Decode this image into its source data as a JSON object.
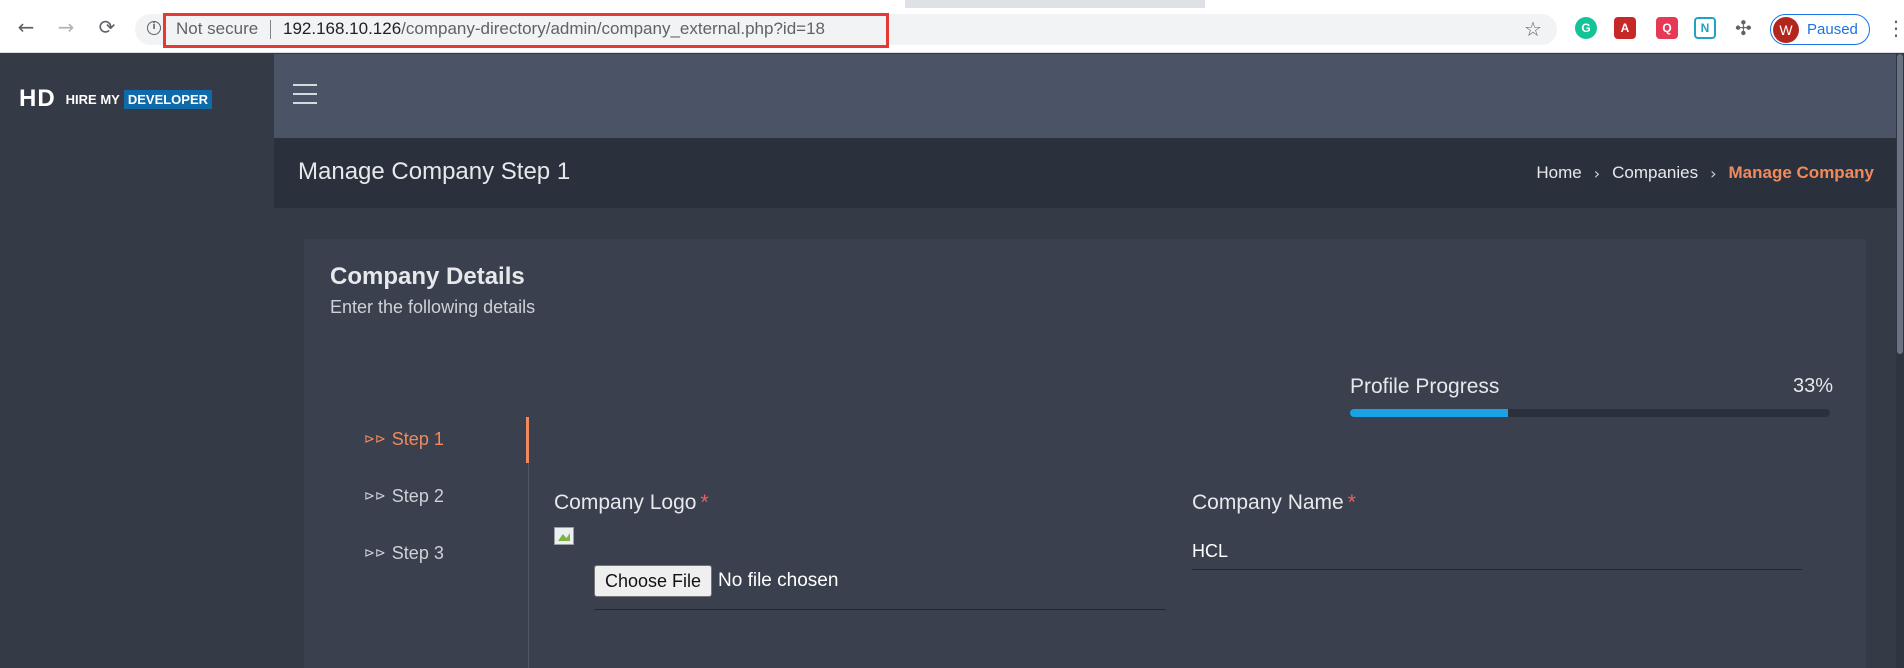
{
  "browser": {
    "security_label": "Not secure",
    "url_host": "192.168.10.126",
    "url_path": "/company-directory/admin/company_external.php?id=18",
    "profile_initial": "W",
    "profile_status": "Paused"
  },
  "sidebar": {
    "logo_mark": "HD",
    "logo_text": "HIRE MY",
    "logo_highlight": "DEVELOPER"
  },
  "header": {
    "page_title": "Manage Company Step 1",
    "breadcrumb": [
      "Home",
      "Companies",
      "Manage Company"
    ]
  },
  "card": {
    "title": "Company Details",
    "subtitle": "Enter the following details",
    "progress_label": "Profile Progress",
    "progress_value": "33%",
    "progress_fraction": 0.33
  },
  "steps": [
    {
      "label": "Step 1",
      "active": true
    },
    {
      "label": "Step 2",
      "active": false
    },
    {
      "label": "Step 3",
      "active": false
    }
  ],
  "form": {
    "logo_label": "Company Logo",
    "name_label": "Company Name",
    "required_mark": "*",
    "file_button": "Choose File",
    "file_status": "No file chosen",
    "company_name": "HCL"
  },
  "colors": {
    "accent": "#f08a5d",
    "progress": "#1aa1e6",
    "url_highlight": "#e53935"
  }
}
